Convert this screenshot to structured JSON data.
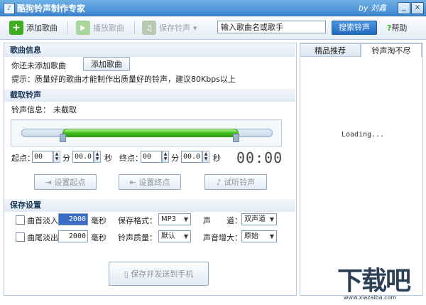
{
  "window": {
    "title": "酷狗铃声制作专家",
    "user": "by 刘鑫",
    "min": "_",
    "close": "×"
  },
  "toolbar": {
    "add": "添加歌曲",
    "play": "播放歌曲",
    "save": "保存铃声",
    "save_arrow": "▾",
    "search_placeholder": "输入歌曲名或歌手",
    "search_btn": "搜索铃声",
    "help": "帮助"
  },
  "song_info": {
    "header": "歌曲信息",
    "not_added": "你还未添加歌曲",
    "add_btn": "添加歌曲",
    "tip": "提示：质量好的歌曲才能制作出质量好的铃声，建议80Kbps以上"
  },
  "clip": {
    "header": "截取铃声",
    "info_label": "铃声信息：",
    "info_value": "未截取",
    "start_label": "起点：",
    "end_label": "终点：",
    "min": "分",
    "sec": "秒",
    "start_min": "00",
    "start_sec": "00.0",
    "end_min": "00",
    "end_sec": "00.0",
    "clock": "00:00",
    "set_start": "设置起点",
    "set_end": "设置终点",
    "preview": "试听铃声"
  },
  "save": {
    "header": "保存设置",
    "fade_in": "曲首淡入",
    "fade_in_val": "2000",
    "fade_out": "曲尾淡出",
    "fade_out_val": "2000",
    "ms": "毫秒",
    "format_label": "保存格式：",
    "format_val": "MP3",
    "channel_label": "声　　道：",
    "channel_val": "双声道",
    "quality_label": "铃声质量：",
    "quality_val": "默认",
    "gain_label": "声音增大：",
    "gain_val": "原始",
    "send_btn": "保存并发送到手机"
  },
  "tabs": {
    "a": "精品推荐",
    "b": "铃声淘不尽"
  },
  "right": {
    "loading": "Loading..."
  },
  "watermark": {
    "main": "下载吧",
    "sub": "www.xiazaiba.com"
  }
}
